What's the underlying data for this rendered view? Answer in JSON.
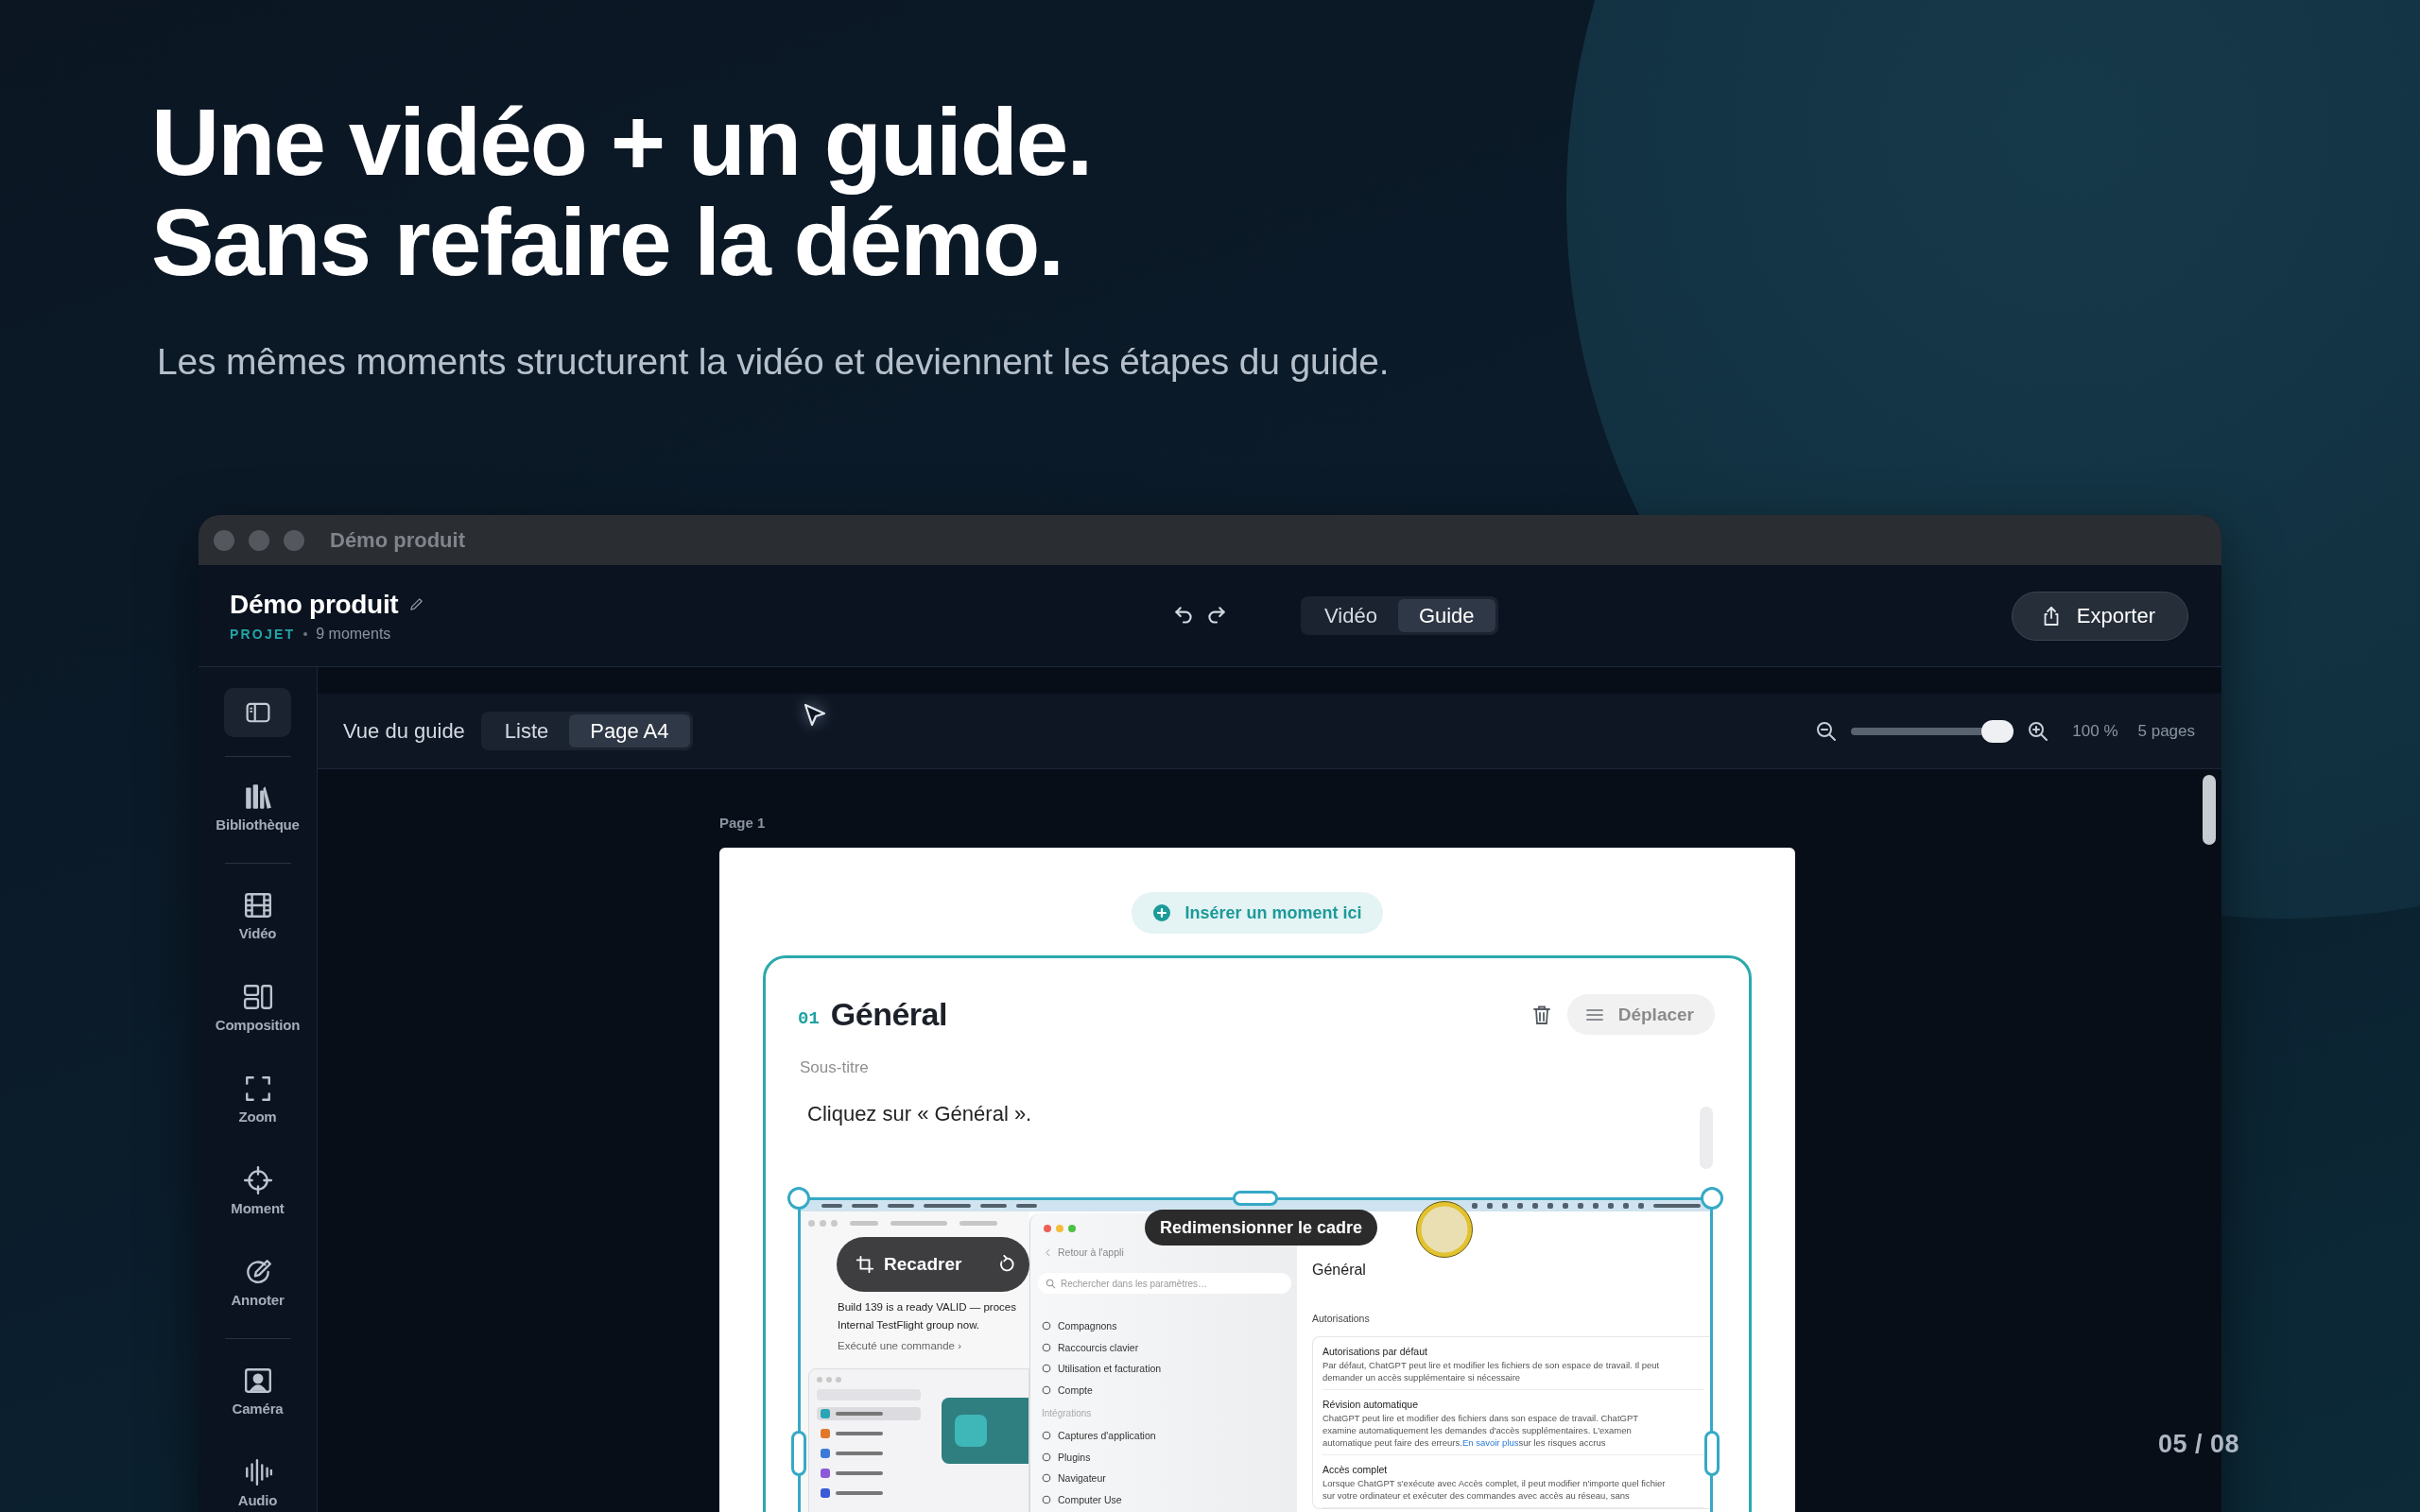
{
  "hero": {
    "title_lines": [
      "Une vidéo + un guide.",
      "Sans refaire la démo."
    ],
    "subtitle": "Les mêmes moments structurent la vidéo et deviennent les étapes du guide."
  },
  "window": {
    "title": "Démo produit"
  },
  "header": {
    "project_name": "Démo produit",
    "project_label": "PROJET",
    "moments": "9 moments",
    "view_tabs": [
      {
        "label": "Vidéo",
        "selected": false
      },
      {
        "label": "Guide",
        "selected": true
      }
    ],
    "export_button": "Exporter"
  },
  "sidebar": {
    "groups": [
      [
        {
          "label": "Bibliothèque"
        }
      ],
      [
        {
          "label": "Vidéo"
        },
        {
          "label": "Composition"
        },
        {
          "label": "Zoom"
        },
        {
          "label": "Moment"
        },
        {
          "label": "Annoter"
        }
      ],
      [
        {
          "label": "Caméra"
        },
        {
          "label": "Audio"
        }
      ]
    ]
  },
  "guide_toolbar": {
    "label": "Vue du guide",
    "modes": [
      {
        "label": "Liste",
        "selected": false
      },
      {
        "label": "Page A4",
        "selected": true
      }
    ],
    "zoom": {
      "level": 1,
      "reading": "100 %"
    },
    "pages": "5 pages"
  },
  "page": {
    "label": "Page 1",
    "insert_button": "Insérer un moment ici",
    "moment": {
      "number": "01",
      "title": "Général",
      "subtitle_label": "Sous-titre",
      "text": "Cliquez sur « Général ».",
      "move_button": "Déplacer",
      "screenshot": {
        "resize_tooltip": "Redimensionner le cadre",
        "crop_button": "Recadrer",
        "chat_lines": [
          "Build 139 is a ready VALID — proces",
          "Internal TestFlight group now."
        ],
        "chat_action": "Exécuté une commande ›",
        "settings": {
          "back": "Retour à l'appli",
          "search_placeholder": "Rechercher dans les paramètres…",
          "items": [
            {
              "label": "Compagnons"
            },
            {
              "label": "Raccourcis clavier"
            },
            {
              "label": "Utilisation et facturation"
            },
            {
              "label": "Compte"
            }
          ],
          "section": "Intégrations",
          "section_items": [
            {
              "label": "Captures d'application"
            },
            {
              "label": "Plugins"
            },
            {
              "label": "Navigateur"
            },
            {
              "label": "Computer Use"
            }
          ]
        },
        "pane": {
          "title": "Général",
          "section": "Autorisations",
          "options": [
            {
              "title": "Autorisations par défaut",
              "description": "Par défaut, ChatGPT peut lire et modifier les fichiers de son espace de travail. Il peut demander un accès supplémentaire si nécessaire"
            },
            {
              "title": "Révision automatique",
              "description": "ChatGPT peut lire et modifier des fichiers dans son espace de travail. ChatGPT examine automatiquement les demandes d'accès supplémentaires. L'examen automatique peut faire des erreurs.",
              "link": "En savoir plus",
              "after": "sur les risques accrus"
            },
            {
              "title": "Accès complet",
              "description": "Lorsque ChatGPT s'exécute avec Accès complet, il peut modifier n'importe quel fichier sur votre ordinateur et exécuter des commandes avec accès au réseau, sans"
            }
          ]
        }
      }
    }
  },
  "slide_counter": "05 / 08"
}
